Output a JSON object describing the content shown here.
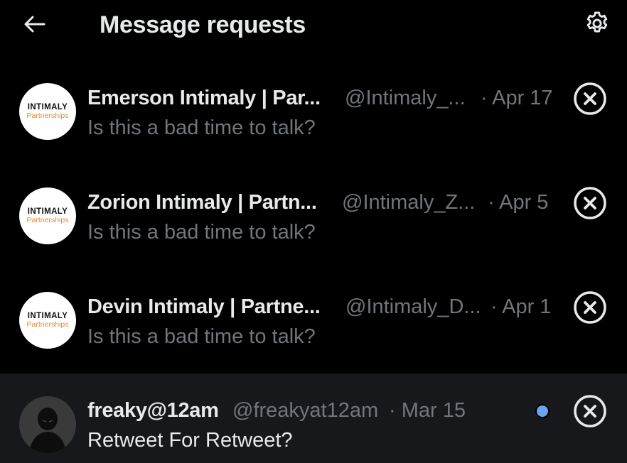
{
  "header": {
    "title": "Message requests",
    "back_icon": "arrow-left-icon",
    "settings_icon": "gear-icon"
  },
  "colors": {
    "background": "#000000",
    "text_primary": "#e7e9ea",
    "text_secondary": "#71767b",
    "unread_background": "#16181c",
    "unread_dot": "#6ba4f0"
  },
  "requests": [
    {
      "name": "Emerson Intimaly | Par...",
      "handle": "@Intimaly_...",
      "date": "· Apr 17",
      "preview": "Is this a bad time to talk?",
      "avatar": {
        "line1": "INTIMALY",
        "line2": "Partnerships"
      },
      "unread": false
    },
    {
      "name": "Zorion Intimaly | Partn...",
      "handle": "@Intimaly_Z...",
      "date": "· Apr 5",
      "preview": "Is this a bad time to talk?",
      "avatar": {
        "line1": "INTIMALY",
        "line2": "Partnerships"
      },
      "unread": false
    },
    {
      "name": "Devin Intimaly | Partne...",
      "handle": "@Intimaly_D...",
      "date": "· Apr 1",
      "preview": "Is this a bad time to talk?",
      "avatar": {
        "line1": "INTIMALY",
        "line2": "Partnerships"
      },
      "unread": false
    },
    {
      "name": "freaky@12am",
      "handle": "@freakyat12am",
      "date": "· Mar 15",
      "preview": "Retweet For Retweet?",
      "avatar": {
        "description": "dark-hooded-figure"
      },
      "unread": true
    }
  ]
}
